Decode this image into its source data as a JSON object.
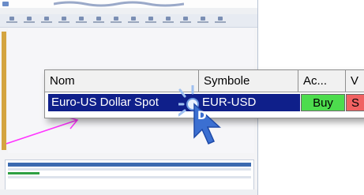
{
  "thumbnail": {
    "title": "",
    "menu_items": [
      "",
      "",
      "",
      "",
      ""
    ],
    "lower_panel_title": ""
  },
  "table": {
    "headers": {
      "name": "Nom",
      "symbol": "Symbole",
      "actions": "Ac...",
      "extra": "V"
    },
    "row": {
      "name": "Euro-US Dollar Spot",
      "symbol": "EUR-USD",
      "buy": "Buy",
      "sell": "S"
    }
  },
  "cursor": {
    "click_label": "D"
  },
  "colors": {
    "selection": "#0f1f8a",
    "buy": "#4ddc4d",
    "sell": "#f06262",
    "pointer_arrow": "#ff33ff",
    "cursor": "#3b6fd1"
  }
}
